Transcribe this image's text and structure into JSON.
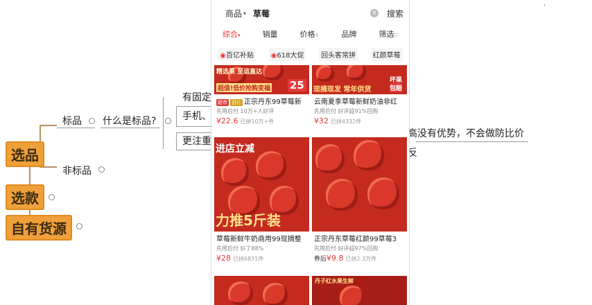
{
  "mindmap": {
    "nodes": [
      "选品",
      "选款",
      "自有货源"
    ],
    "branches": [
      "标品",
      "非标品"
    ],
    "question": "什么是标品?",
    "sub1": "有固定",
    "sub2": "手机、",
    "sub3": "更注重",
    "right1": "高没有优势，不会做防比价",
    "right2": "反"
  },
  "phone": {
    "search_category": "商品",
    "search_query": "草莓",
    "search_button": "搜索",
    "sort_tabs": [
      "综合",
      "销量",
      "价格",
      "品牌",
      "筛选"
    ],
    "filter_chips": [
      "百亿补贴",
      "618大促",
      "回头客常拼",
      "红颜草莓"
    ],
    "products": [
      {
        "banner_top": "精选果 至运直达",
        "banner_bottom": "超值!低价抢购变福",
        "badge_num": "25",
        "tag1": "超市",
        "tag2": "百亿",
        "title": "正宗丹东99草莓新",
        "meta": "先用后付 10万+人好评",
        "price": "¥22.6",
        "sold": "已拼10万+件"
      },
      {
        "banner_top": "坏果",
        "banner_mid": "包赔",
        "banner_bottom": "现摘现发 常年供货",
        "title": "云南夏季草莓新鲜奶油非红",
        "meta": "先用后付 好评超91%回购",
        "price": "¥32",
        "sold": "已拼4332件"
      },
      {
        "banner_top": "进店立减",
        "banner_bottom": "力推5斤装",
        "title": "草莓新鲜牛奶商用99现摘整",
        "meta": "先用后付 好了88%",
        "price": "¥28",
        "sold": "已拼6831件"
      },
      {
        "title": "正宗丹东草莓红颜99草莓3",
        "meta": "先用后付 好评超97%回购",
        "price": "¥9.8",
        "price_prefix": "券后",
        "sold": "已拼2.3万件"
      }
    ],
    "bottom_banner": "丹子红水果生鲜"
  }
}
